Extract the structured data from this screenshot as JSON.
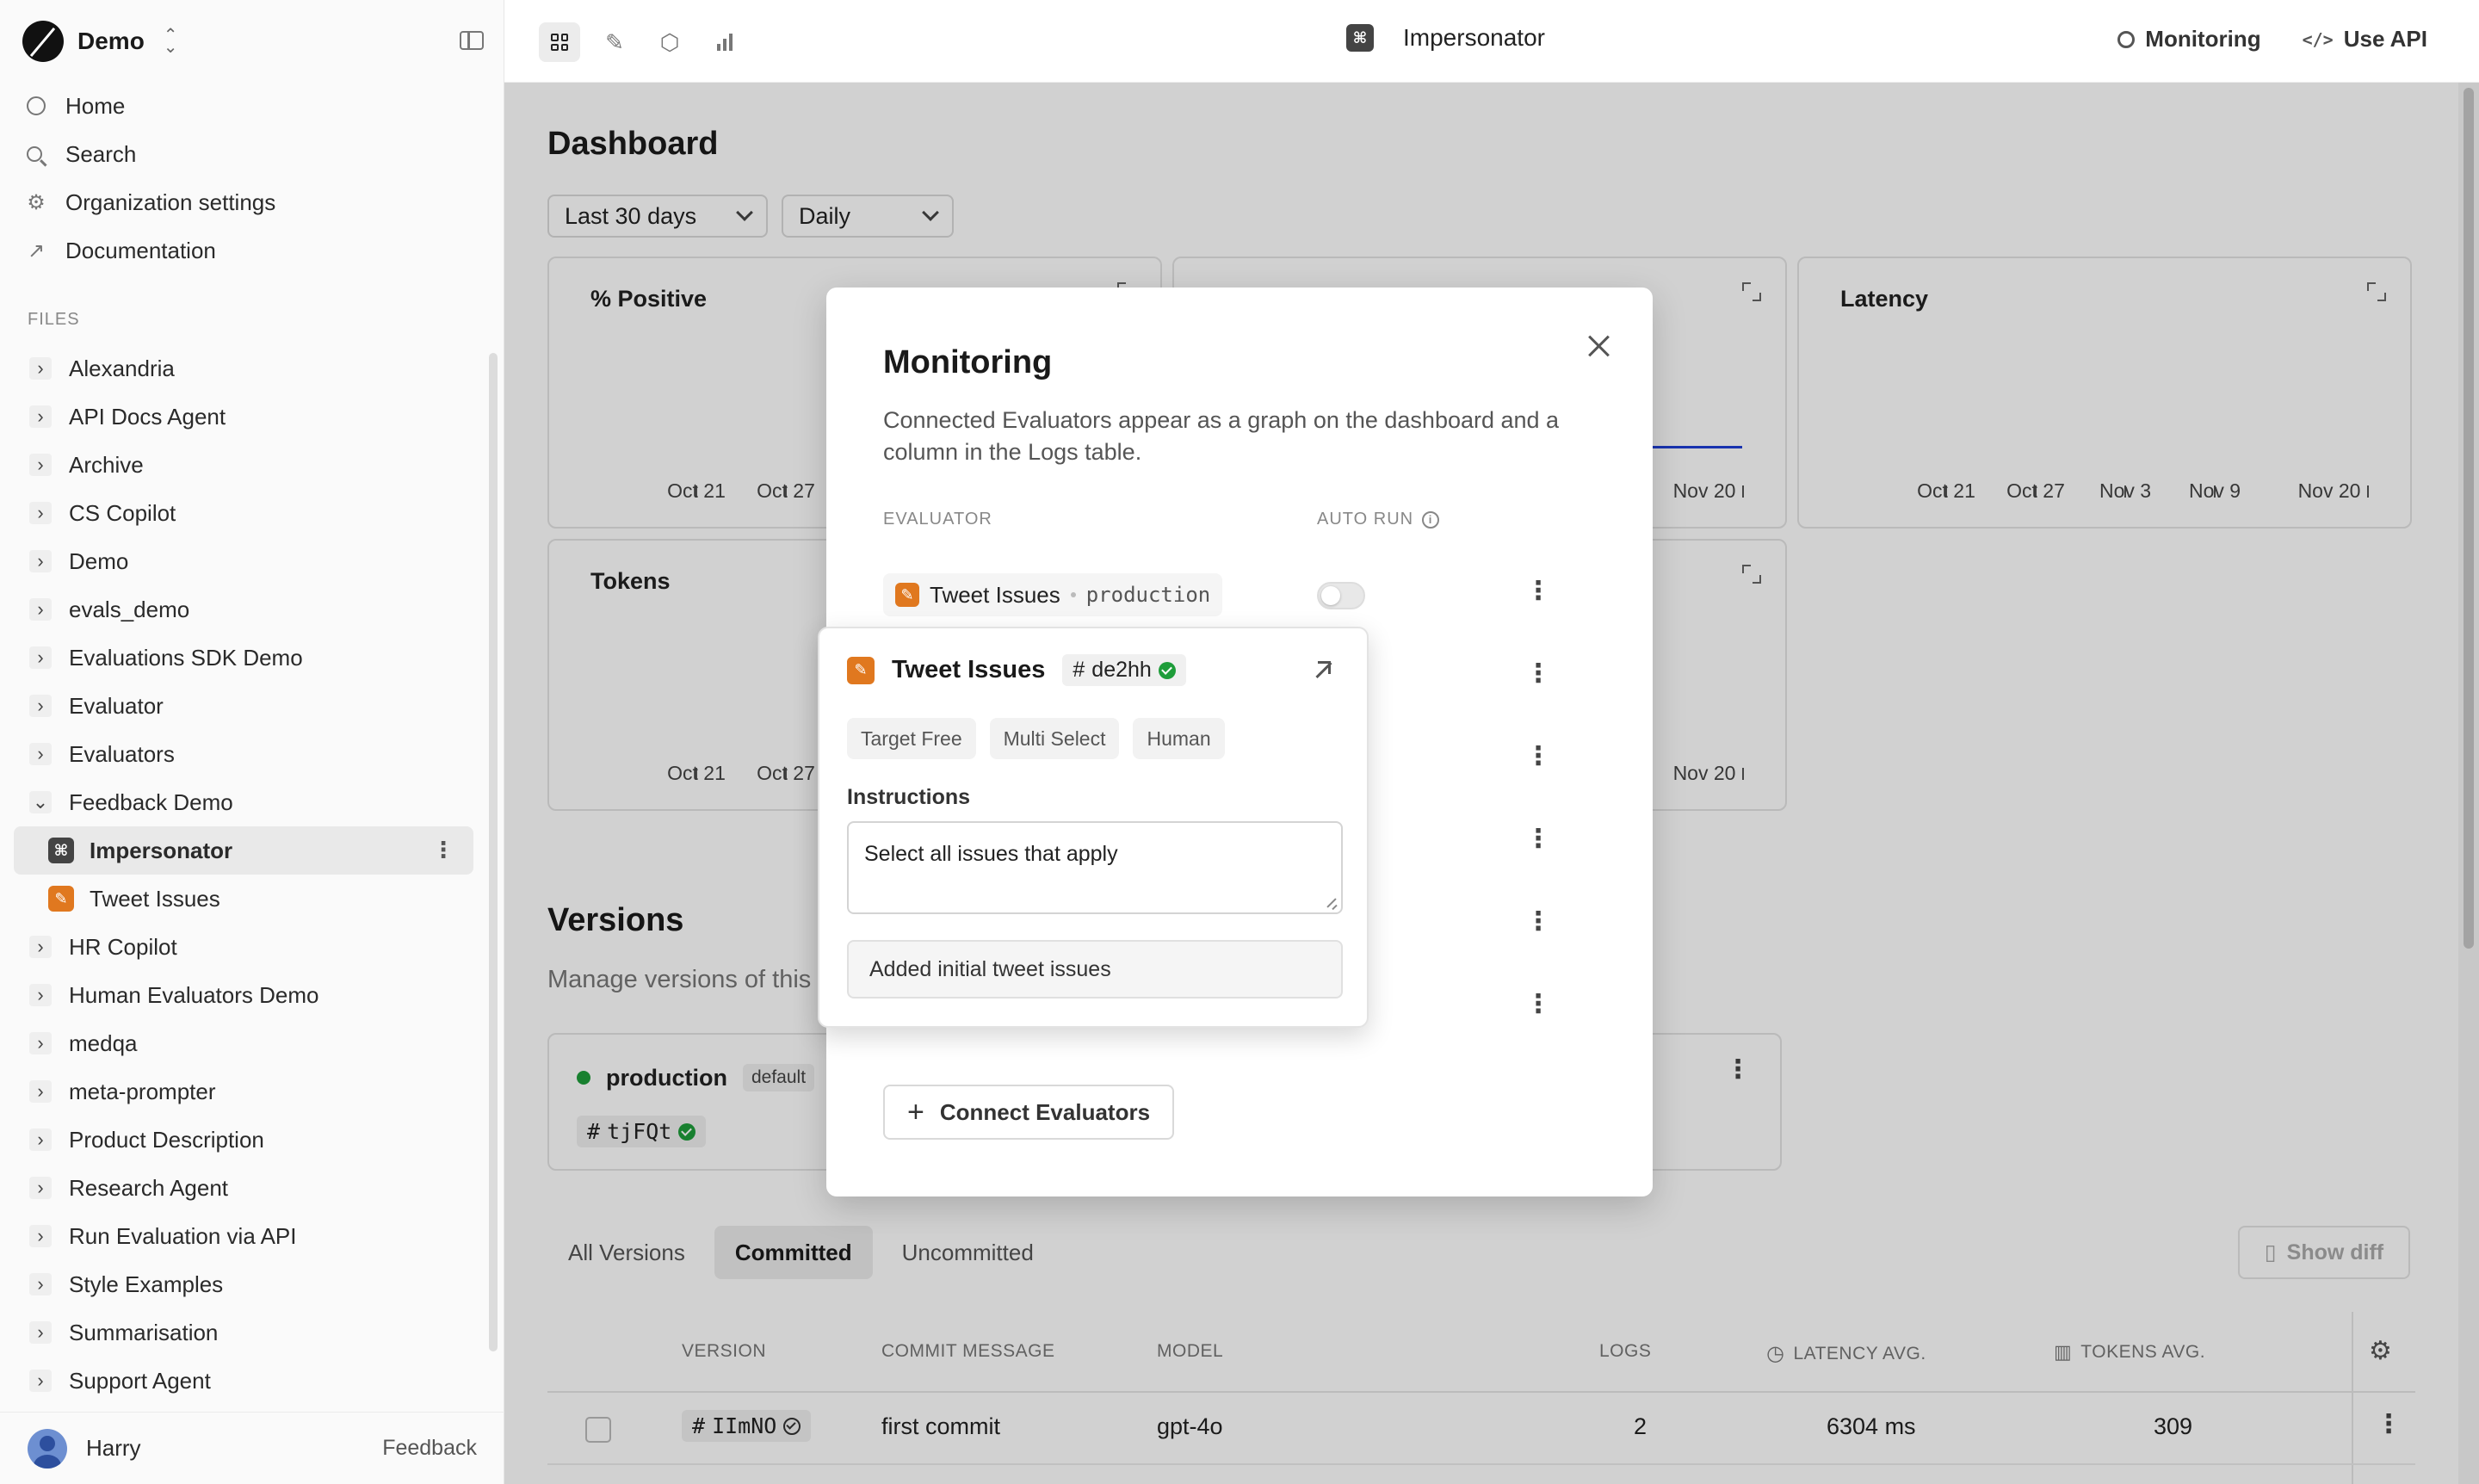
{
  "workspace": {
    "name": "Demo"
  },
  "sidebar": {
    "nav": [
      {
        "label": "Home",
        "icon": "home-circle-icon"
      },
      {
        "label": "Search",
        "icon": "search-icon"
      },
      {
        "label": "Organization settings",
        "icon": "gear-icon"
      },
      {
        "label": "Documentation",
        "icon": "external-link-icon"
      }
    ],
    "files_label": "FILES",
    "tree": [
      {
        "label": "Alexandria",
        "type": "folder",
        "expanded": false
      },
      {
        "label": "API Docs Agent",
        "type": "folder",
        "expanded": false
      },
      {
        "label": "Archive",
        "type": "folder",
        "expanded": false
      },
      {
        "label": "CS Copilot",
        "type": "folder",
        "expanded": false
      },
      {
        "label": "Demo",
        "type": "folder",
        "expanded": false
      },
      {
        "label": "evals_demo",
        "type": "folder",
        "expanded": false
      },
      {
        "label": "Evaluations SDK Demo",
        "type": "folder",
        "expanded": false
      },
      {
        "label": "Evaluator",
        "type": "folder",
        "expanded": false
      },
      {
        "label": "Evaluators",
        "type": "folder",
        "expanded": false
      },
      {
        "label": "Feedback Demo",
        "type": "folder",
        "expanded": true
      },
      {
        "label": "Impersonator",
        "type": "prompt",
        "active": true
      },
      {
        "label": "Tweet Issues",
        "type": "evaluator"
      },
      {
        "label": "HR Copilot",
        "type": "folder",
        "expanded": false
      },
      {
        "label": "Human Evaluators Demo",
        "type": "folder",
        "expanded": false
      },
      {
        "label": "medqa",
        "type": "folder",
        "expanded": false
      },
      {
        "label": "meta-prompter",
        "type": "folder",
        "expanded": false
      },
      {
        "label": "Product Description",
        "type": "folder",
        "expanded": false
      },
      {
        "label": "Research Agent",
        "type": "folder",
        "expanded": false
      },
      {
        "label": "Run Evaluation via API",
        "type": "folder",
        "expanded": false
      },
      {
        "label": "Style Examples",
        "type": "folder",
        "expanded": false
      },
      {
        "label": "Summarisation",
        "type": "folder",
        "expanded": false
      },
      {
        "label": "Support Agent",
        "type": "folder",
        "expanded": false
      }
    ],
    "user": {
      "name": "Harry"
    },
    "feedback_label": "Feedback"
  },
  "topbar": {
    "file_title": "Impersonator",
    "monitoring_label": "Monitoring",
    "use_api_label": "Use API"
  },
  "dashboard": {
    "title": "Dashboard",
    "range_select": "Last 30 days",
    "interval_select": "Daily",
    "cards": {
      "positive": {
        "title": "% Positive",
        "ticks": [
          "Oct 21",
          "Oct 27"
        ]
      },
      "middle_top": {
        "ticks": [
          "Nov 20"
        ]
      },
      "latency": {
        "title": "Latency",
        "ticks": [
          "Oct 21",
          "Oct 27",
          "Nov 3",
          "Nov 9",
          "Nov 20"
        ]
      },
      "tokens": {
        "title": "Tokens",
        "ticks": [
          "Oct 21",
          "Oct 27"
        ]
      },
      "middle_bottom": {
        "ticks": [
          "Nov 20"
        ]
      }
    }
  },
  "versions": {
    "title": "Versions",
    "subtitle": "Manage versions of this",
    "production": {
      "env": "production",
      "badge": "default",
      "hash": "tjFQt"
    },
    "tabs": [
      {
        "label": "All Versions",
        "active": false
      },
      {
        "label": "Committed",
        "active": true
      },
      {
        "label": "Uncommitted",
        "active": false
      }
    ],
    "show_diff_label": "Show diff",
    "columns": [
      "VERSION",
      "COMMIT MESSAGE",
      "MODEL",
      "LOGS",
      "LATENCY AVG.",
      "TOKENS AVG."
    ],
    "rows": [
      {
        "version": "IImNO",
        "commit_message": "first commit",
        "model": "gpt-4o",
        "logs": "2",
        "latency": "6304 ms",
        "tokens": "309"
      }
    ]
  },
  "modal": {
    "title": "Monitoring",
    "description": "Connected Evaluators appear as a graph on the dashboard and a column in the Logs table.",
    "col_evaluator": "EVALUATOR",
    "col_auto_run": "AUTO RUN",
    "rows": [
      {
        "name": "Tweet Issues",
        "env": "production",
        "auto_run": false
      }
    ],
    "connect_label": "Connect Evaluators"
  },
  "popover": {
    "name": "Tweet Issues",
    "hash": "de2hh",
    "tags": [
      "Target Free",
      "Multi Select",
      "Human"
    ],
    "instructions_label": "Instructions",
    "instructions_value": "Select all issues that apply",
    "commit_message": "Added initial tweet issues"
  },
  "colors": {
    "accent_line": "#1f3fd6",
    "evaluator_orange": "#e0781f",
    "status_green": "#1e9d3a"
  }
}
